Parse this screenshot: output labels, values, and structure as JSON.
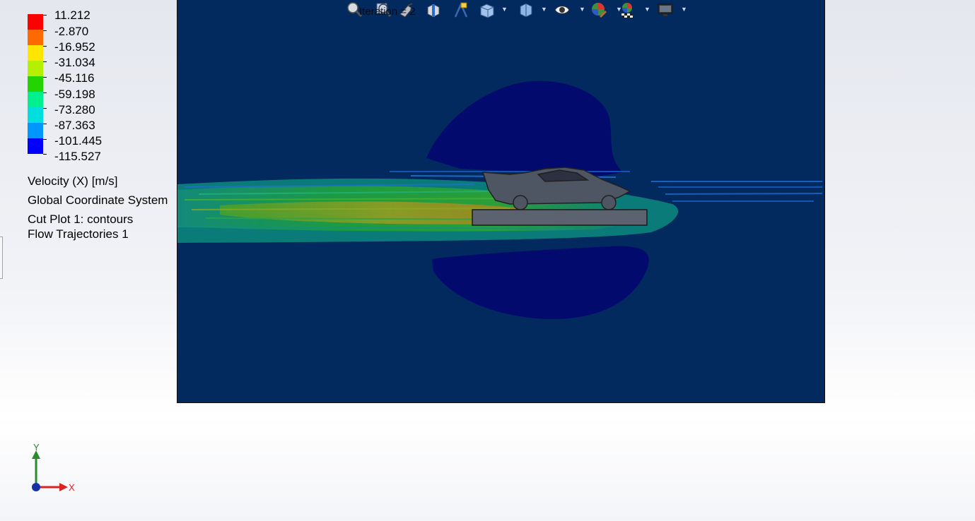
{
  "toolbar": {
    "overlay_text": "Iteration = 2",
    "icons": [
      "zoom-to-fit-icon",
      "zoom-area-icon",
      "previous-view-icon",
      "section-view-icon",
      "dynamic-annotation-icon",
      "view-orientation-icon",
      "display-style-icon",
      "hide-show-icon",
      "edit-appearance-icon",
      "apply-scene-icon",
      "view-settings-icon"
    ]
  },
  "legend": {
    "colors": [
      "#ff0000",
      "#ff6a00",
      "#ffd000",
      "#b5f000",
      "#2ede00",
      "#00ff88",
      "#00e1e1",
      "#0096ff",
      "#0000ff"
    ],
    "values": [
      "11.212",
      "-2.870",
      "-16.952",
      "-31.034",
      "-45.116",
      "-59.198",
      "-73.280",
      "-87.363",
      "-101.445",
      "-115.527"
    ]
  },
  "info": {
    "parameter": "Velocity (X) [m/s]",
    "coordinate_system": "Global Coordinate System",
    "cut_plot": "Cut Plot 1: contours",
    "trajectories": "Flow Trajectories 1"
  },
  "triad": {
    "x_label": "X",
    "y_label": "Y"
  },
  "colors": {
    "background": "#032a5f",
    "low_region": "#020a6e",
    "wake_cyan": "#0a9c8a",
    "wake_green": "#1fa33c",
    "wake_yellow": "#9aa521"
  }
}
